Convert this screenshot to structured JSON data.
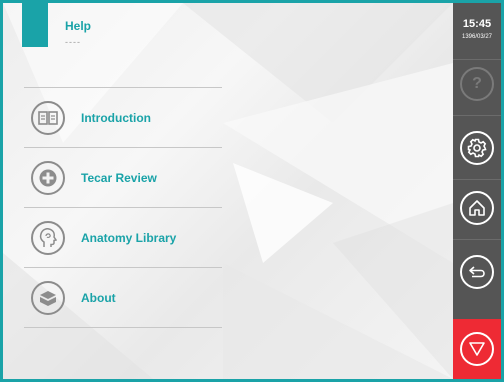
{
  "header": {
    "title": "Help",
    "subtitle": "----"
  },
  "menu": {
    "items": [
      {
        "label": "Introduction",
        "icon": "book-icon"
      },
      {
        "label": "Tecar Review",
        "icon": "plus-icon"
      },
      {
        "label": "Anatomy Library",
        "icon": "head-profile-icon"
      },
      {
        "label": "About",
        "icon": "box-icon"
      }
    ]
  },
  "sidebar": {
    "time": "15:45",
    "date": "1396/03/27",
    "help_symbol": "?",
    "buttons": [
      "help-icon",
      "gear-icon",
      "home-icon",
      "back-icon",
      "stop-icon"
    ]
  },
  "colors": {
    "accent": "#1aa3a8",
    "sidebar": "#555555",
    "stop": "#ee2a34"
  }
}
